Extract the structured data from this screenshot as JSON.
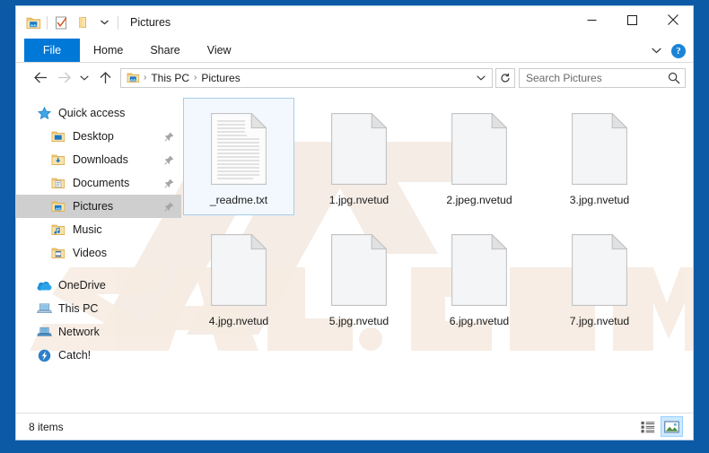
{
  "window": {
    "title": "Pictures",
    "quick_access_icons": [
      "pictures-folder-icon",
      "properties-icon",
      "new-folder-icon",
      "customize-qat-chevron-icon"
    ],
    "controls": {
      "minimize": "minimize-button",
      "maximize": "maximize-button",
      "close": "close-button"
    }
  },
  "ribbon": {
    "tabs": [
      {
        "label": "File",
        "active": true
      },
      {
        "label": "Home",
        "active": false
      },
      {
        "label": "Share",
        "active": false
      },
      {
        "label": "View",
        "active": false
      }
    ],
    "collapse_icon": "chevron-down-icon",
    "help_label": "?"
  },
  "address": {
    "back": "back-arrow-icon",
    "forward": "forward-arrow-icon",
    "recent": "recent-locations-chevron-icon",
    "up": "up-arrow-icon",
    "crumb_icon": "pictures-folder-icon",
    "crumbs": [
      "This PC",
      "Pictures"
    ],
    "separator": "›",
    "dropdown_icon": "chevron-down-icon",
    "refresh_icon": "refresh-icon"
  },
  "search": {
    "placeholder": "Search Pictures",
    "value": "Search Pictures",
    "icon": "search-icon"
  },
  "sidebar": {
    "items": [
      {
        "label": "Quick access",
        "icon": "star-icon",
        "level": 0,
        "pinned": false,
        "selected": false
      },
      {
        "label": "Desktop",
        "icon": "desktop-folder-icon",
        "level": 1,
        "pinned": true,
        "selected": false
      },
      {
        "label": "Downloads",
        "icon": "downloads-folder-icon",
        "level": 1,
        "pinned": true,
        "selected": false
      },
      {
        "label": "Documents",
        "icon": "documents-folder-icon",
        "level": 1,
        "pinned": true,
        "selected": false
      },
      {
        "label": "Pictures",
        "icon": "pictures-folder-icon",
        "level": 1,
        "pinned": true,
        "selected": true
      },
      {
        "label": "Music",
        "icon": "music-folder-icon",
        "level": 1,
        "pinned": false,
        "selected": false
      },
      {
        "label": "Videos",
        "icon": "videos-folder-icon",
        "level": 1,
        "pinned": false,
        "selected": false
      },
      {
        "label": "OneDrive",
        "icon": "onedrive-cloud-icon",
        "level": 0,
        "pinned": false,
        "selected": false
      },
      {
        "label": "This PC",
        "icon": "this-pc-icon",
        "level": 0,
        "pinned": false,
        "selected": false
      },
      {
        "label": "Network",
        "icon": "network-icon",
        "level": 0,
        "pinned": false,
        "selected": false
      },
      {
        "label": "Catch!",
        "icon": "catch-icon",
        "level": 0,
        "pinned": false,
        "selected": false
      }
    ]
  },
  "files": [
    {
      "name": "_readme.txt",
      "icon": "text-document-icon",
      "selected": true
    },
    {
      "name": "1.jpg.nvetud",
      "icon": "blank-document-icon",
      "selected": false
    },
    {
      "name": "2.jpeg.nvetud",
      "icon": "blank-document-icon",
      "selected": false
    },
    {
      "name": "3.jpg.nvetud",
      "icon": "blank-document-icon",
      "selected": false
    },
    {
      "name": "4.jpg.nvetud",
      "icon": "blank-document-icon",
      "selected": false
    },
    {
      "name": "5.jpg.nvetud",
      "icon": "blank-document-icon",
      "selected": false
    },
    {
      "name": "6.jpg.nvetud",
      "icon": "blank-document-icon",
      "selected": false
    },
    {
      "name": "7.jpg.nvetud",
      "icon": "blank-document-icon",
      "selected": false
    }
  ],
  "status": {
    "item_count": "8 items",
    "views": [
      {
        "icon": "details-view-icon",
        "active": false
      },
      {
        "icon": "large-icons-view-icon",
        "active": true
      }
    ]
  },
  "colors": {
    "desktop_blue": "#0c5aa6",
    "accent_blue": "#0078d7",
    "selection_border": "#a5cdec",
    "nav_selected": "#cfcfcf",
    "help_blue": "#1b84d6"
  }
}
